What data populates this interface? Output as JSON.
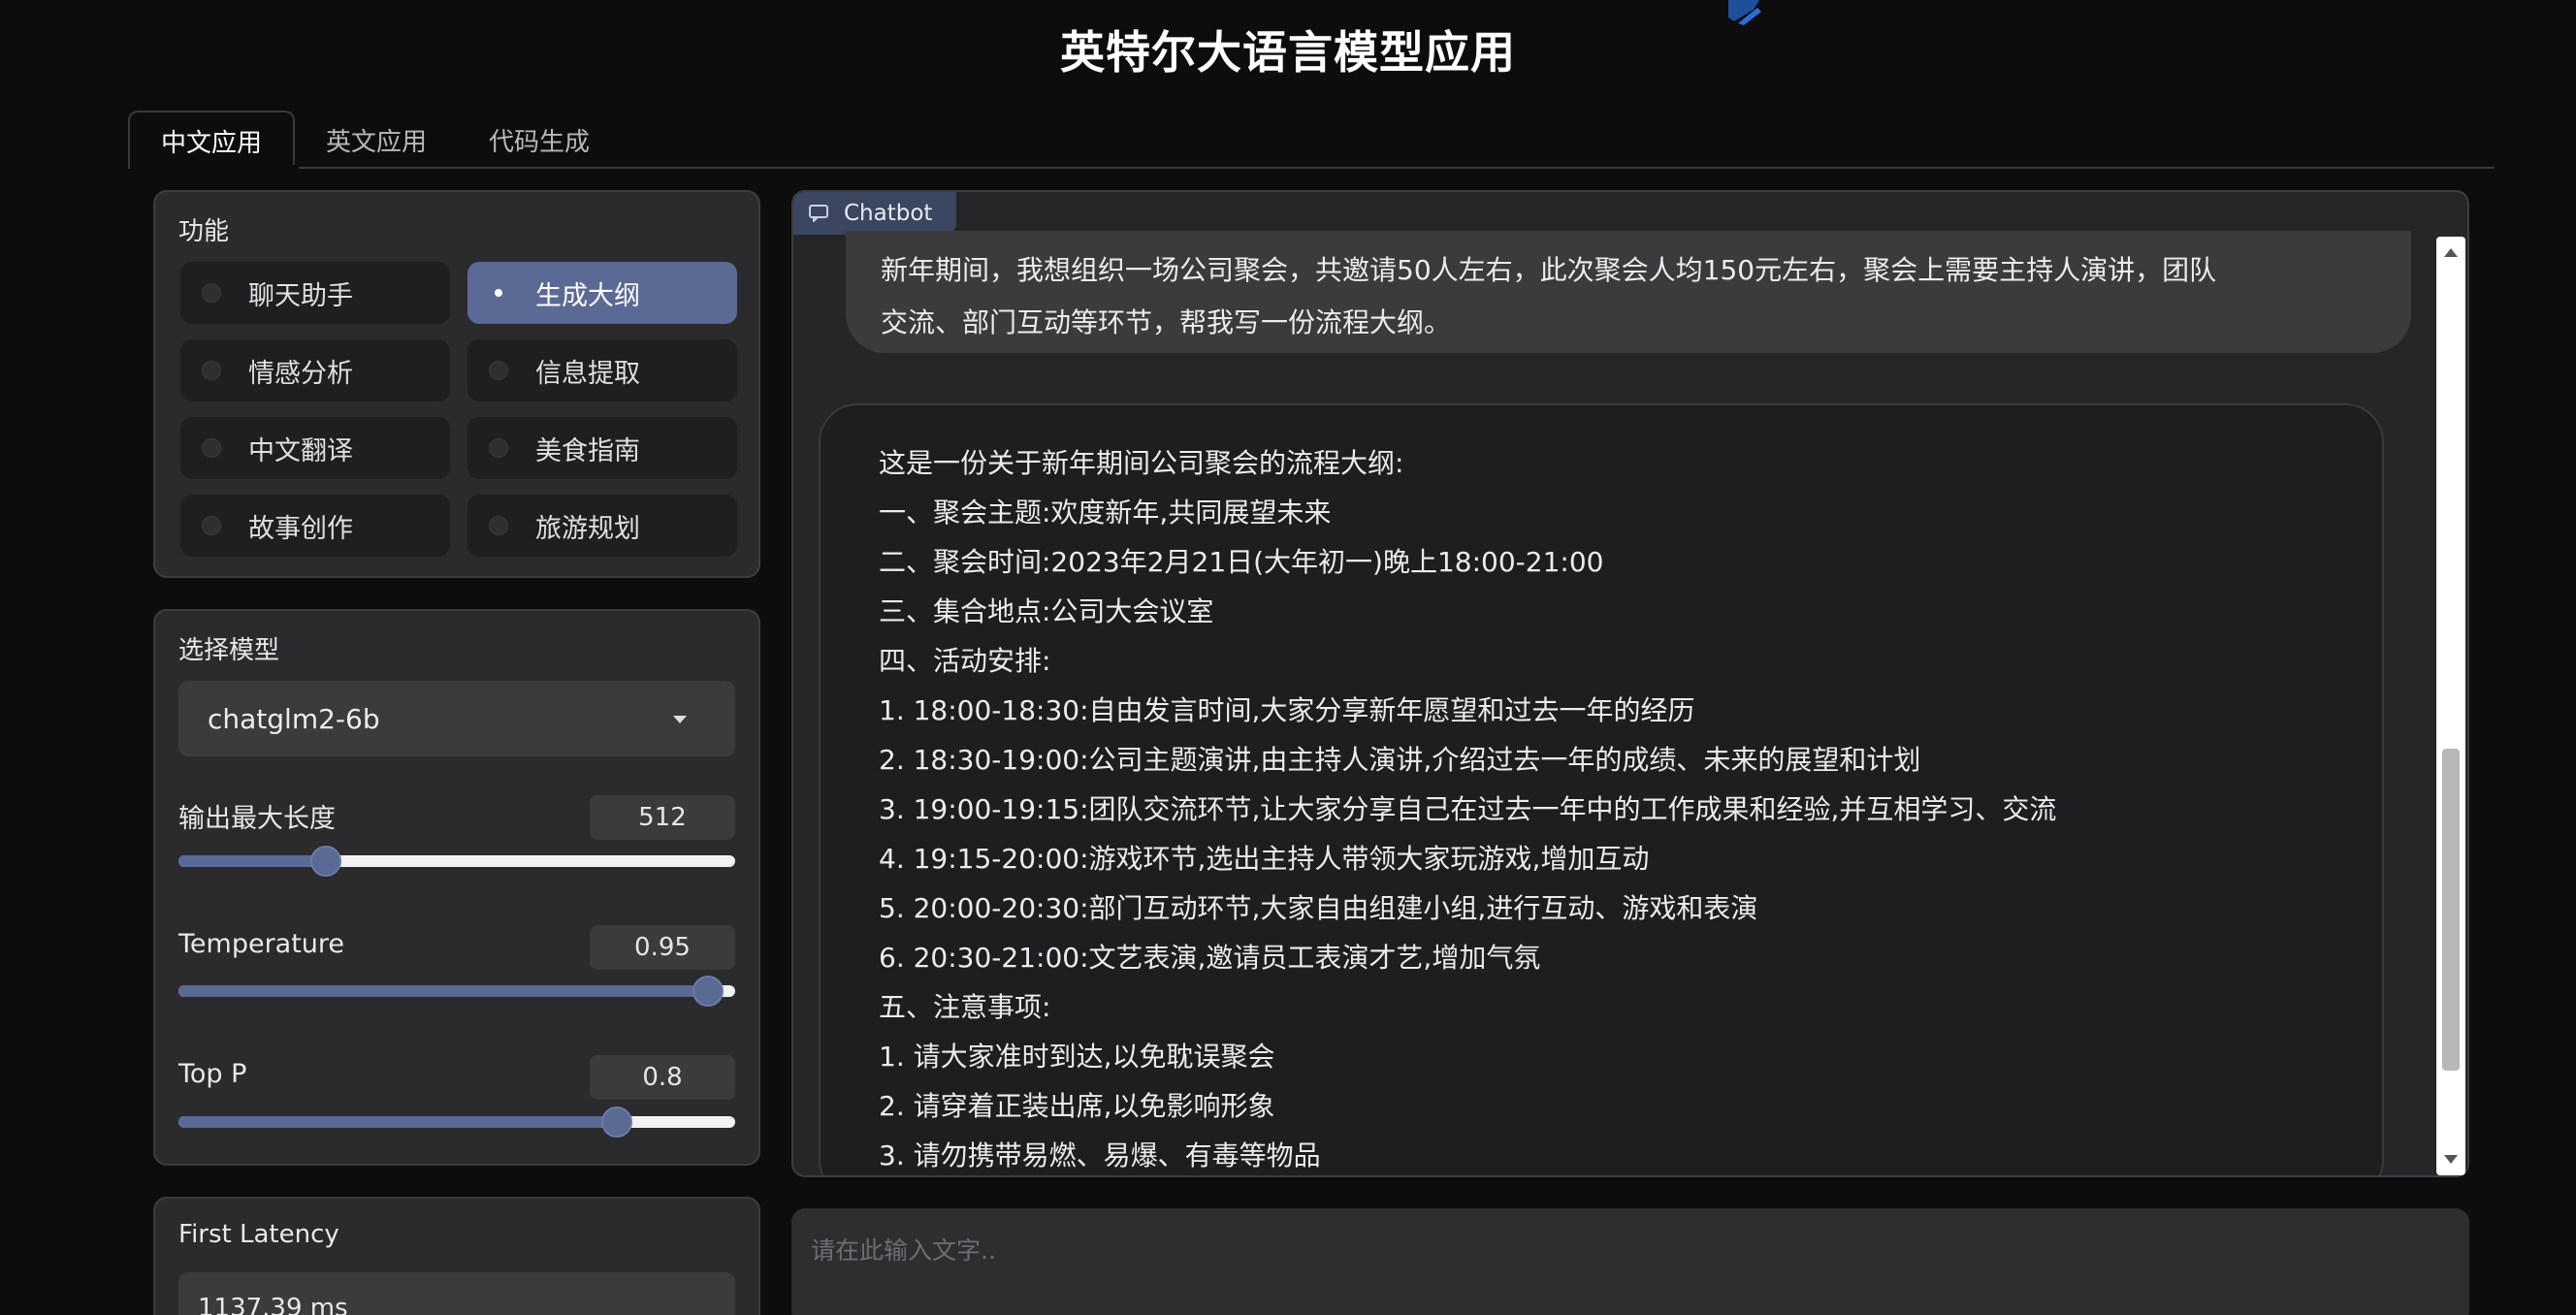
{
  "app": {
    "title": "英特尔大语言模型应用"
  },
  "tabs": [
    {
      "label": "中文应用",
      "active": true
    },
    {
      "label": "英文应用",
      "active": false
    },
    {
      "label": "代码生成",
      "active": false
    }
  ],
  "functions": {
    "label": "功能",
    "selected": "生成大纲",
    "options": [
      "聊天助手",
      "生成大纲",
      "情感分析",
      "信息提取",
      "中文翻译",
      "美食指南",
      "故事创作",
      "旅游规划"
    ]
  },
  "model": {
    "label": "选择模型",
    "selected": "chatglm2-6b",
    "max_length": {
      "label": "输出最大长度",
      "value": "512",
      "fraction": 0.19
    },
    "temperature": {
      "label": "Temperature",
      "value": "0.95",
      "fraction": 0.95
    },
    "top_p": {
      "label": "Top P",
      "value": "0.8",
      "fraction": 0.8
    }
  },
  "latency": {
    "label": "First Latency",
    "value": "1137.39 ms"
  },
  "chatbot": {
    "badge": "Chatbot",
    "user_message": [
      "新年期间，我想组织一场公司聚会，共邀请50人左右，此次聚会人均150元左右，聚会上需要主持人演讲，团队",
      "交流、部门互动等环节，帮我写一份流程大纲。"
    ],
    "bot_message": [
      "这是一份关于新年期间公司聚会的流程大纲:",
      "一、聚会主题:欢度新年,共同展望未来",
      "二、聚会时间:2023年2月21日(大年初一)晚上18:00-21:00",
      "三、集合地点:公司大会议室",
      "四、活动安排:",
      "1. 18:00-18:30:自由发言时间,大家分享新年愿望和过去一年的经历",
      "2. 18:30-19:00:公司主题演讲,由主持人演讲,介绍过去一年的成绩、未来的展望和计划",
      "3. 19:00-19:15:团队交流环节,让大家分享自己在过去一年中的工作成果和经验,并互相学习、交流",
      "4. 19:15-20:00:游戏环节,选出主持人带领大家玩游戏,增加互动",
      "5. 20:00-20:30:部门互动环节,大家自由组建小组,进行互动、游戏和表演",
      "6. 20:30-21:00:文艺表演,邀请员工表演才艺,增加气氛",
      "五、注意事项:",
      "1. 请大家准时到达,以免耽误聚会",
      "2. 请穿着正装出席,以免影响形象",
      "3. 请勿携带易燃、易爆、有毒等物品"
    ]
  },
  "input": {
    "placeholder": "请在此输入文字.."
  },
  "colors": {
    "accent": "#5b6995",
    "background": "#0d0d0e",
    "panel": "#2b2b2d"
  }
}
